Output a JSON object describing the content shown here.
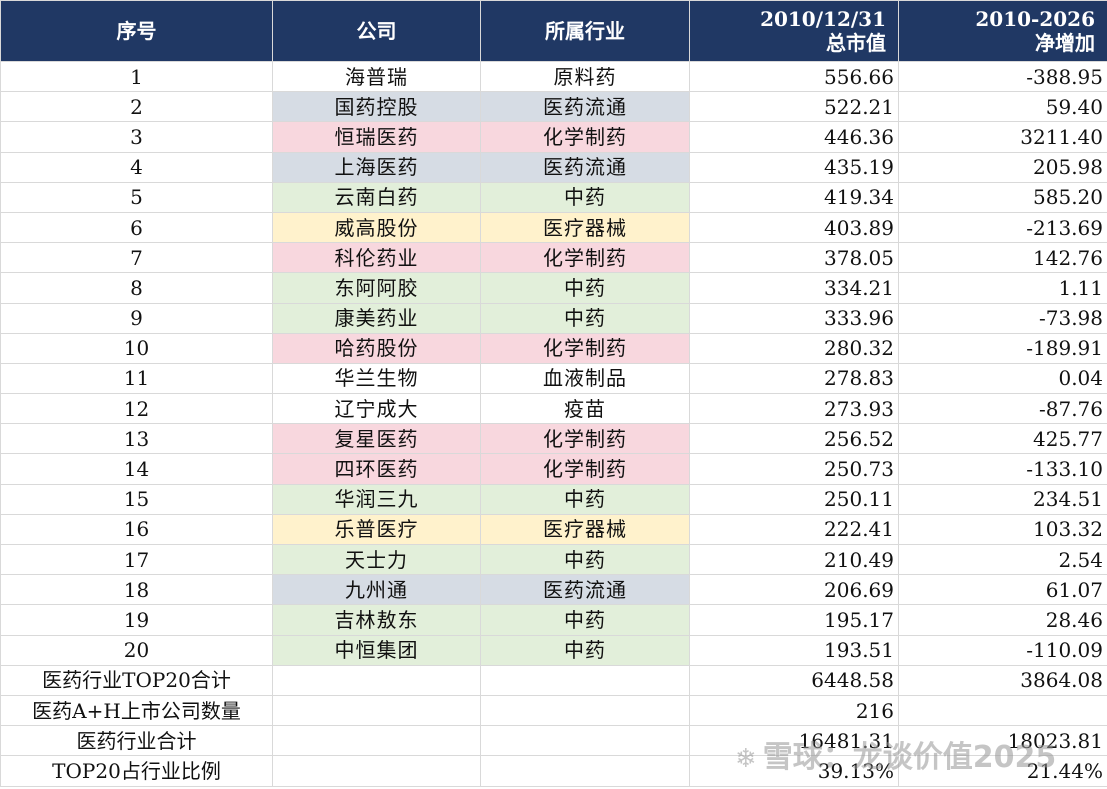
{
  "colors": {
    "header_bg": "#203864",
    "header_text": "#ffffff",
    "medical_distribution": "#d6dce4",
    "chemical_pharma": "#f8d7de",
    "tcm": "#e2efda",
    "medical_device": "#fff2cc",
    "default": "#ffffff"
  },
  "header": {
    "rank": "序号",
    "company": "公司",
    "industry": "所属行业",
    "mktcap_line1": "2010/12/31",
    "mktcap_line2": "总市值",
    "netinc_line1": "2010-2026",
    "netinc_line2": "净增加"
  },
  "rows": [
    {
      "rank": "1",
      "company": "海普瑞",
      "industry": "原料药",
      "mktcap": "556.66",
      "net": "-388.95",
      "color": "default"
    },
    {
      "rank": "2",
      "company": "国药控股",
      "industry": "医药流通",
      "mktcap": "522.21",
      "net": "59.40",
      "color": "medical_distribution"
    },
    {
      "rank": "3",
      "company": "恒瑞医药",
      "industry": "化学制药",
      "mktcap": "446.36",
      "net": "3211.40",
      "color": "chemical_pharma"
    },
    {
      "rank": "4",
      "company": "上海医药",
      "industry": "医药流通",
      "mktcap": "435.19",
      "net": "205.98",
      "color": "medical_distribution"
    },
    {
      "rank": "5",
      "company": "云南白药",
      "industry": "中药",
      "mktcap": "419.34",
      "net": "585.20",
      "color": "tcm"
    },
    {
      "rank": "6",
      "company": "威高股份",
      "industry": "医疗器械",
      "mktcap": "403.89",
      "net": "-213.69",
      "color": "medical_device"
    },
    {
      "rank": "7",
      "company": "科伦药业",
      "industry": "化学制药",
      "mktcap": "378.05",
      "net": "142.76",
      "color": "chemical_pharma"
    },
    {
      "rank": "8",
      "company": "东阿阿胶",
      "industry": "中药",
      "mktcap": "334.21",
      "net": "1.11",
      "color": "tcm"
    },
    {
      "rank": "9",
      "company": "康美药业",
      "industry": "中药",
      "mktcap": "333.96",
      "net": "-73.98",
      "color": "tcm"
    },
    {
      "rank": "10",
      "company": "哈药股份",
      "industry": "化学制药",
      "mktcap": "280.32",
      "net": "-189.91",
      "color": "chemical_pharma"
    },
    {
      "rank": "11",
      "company": "华兰生物",
      "industry": "血液制品",
      "mktcap": "278.83",
      "net": "0.04",
      "color": "default"
    },
    {
      "rank": "12",
      "company": "辽宁成大",
      "industry": "疫苗",
      "mktcap": "273.93",
      "net": "-87.76",
      "color": "default"
    },
    {
      "rank": "13",
      "company": "复星医药",
      "industry": "化学制药",
      "mktcap": "256.52",
      "net": "425.77",
      "color": "chemical_pharma"
    },
    {
      "rank": "14",
      "company": "四环医药",
      "industry": "化学制药",
      "mktcap": "250.73",
      "net": "-133.10",
      "color": "chemical_pharma"
    },
    {
      "rank": "15",
      "company": "华润三九",
      "industry": "中药",
      "mktcap": "250.11",
      "net": "234.51",
      "color": "tcm"
    },
    {
      "rank": "16",
      "company": "乐普医疗",
      "industry": "医疗器械",
      "mktcap": "222.41",
      "net": "103.32",
      "color": "medical_device"
    },
    {
      "rank": "17",
      "company": "天士力",
      "industry": "中药",
      "mktcap": "210.49",
      "net": "2.54",
      "color": "tcm"
    },
    {
      "rank": "18",
      "company": "九州通",
      "industry": "医药流通",
      "mktcap": "206.69",
      "net": "61.07",
      "color": "medical_distribution"
    },
    {
      "rank": "19",
      "company": "吉林敖东",
      "industry": "中药",
      "mktcap": "195.17",
      "net": "28.46",
      "color": "tcm"
    },
    {
      "rank": "20",
      "company": "中恒集团",
      "industry": "中药",
      "mktcap": "193.51",
      "net": "-110.09",
      "color": "tcm"
    }
  ],
  "summary": [
    {
      "label": "医药行业TOP20合计",
      "mktcap": "6448.58",
      "net": "3864.08"
    },
    {
      "label": "医药A+H上市公司数量",
      "mktcap": "216",
      "net": ""
    },
    {
      "label": "医药行业合计",
      "mktcap": "16481.31",
      "net": "18023.81"
    },
    {
      "label": "TOP20占行业比例",
      "mktcap": "39.13%",
      "net": "21.44%"
    }
  ],
  "watermark": {
    "icon": "snowball-icon",
    "text": "雪球：龙谈价值2025"
  }
}
